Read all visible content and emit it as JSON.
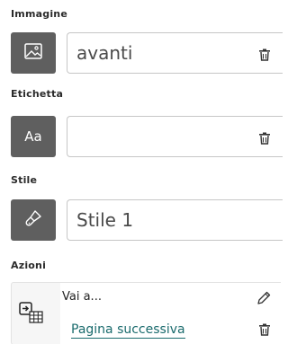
{
  "sections": {
    "image": {
      "label": "Immagine",
      "value": "avanti"
    },
    "label": {
      "label": "Etichetta",
      "value": "",
      "icon_text": "Aa"
    },
    "style": {
      "label": "Stile",
      "value": "Stile 1"
    },
    "actions": {
      "label": "Azioni",
      "items": [
        {
          "title": "Vai a...",
          "target": "Pagina successiva"
        }
      ]
    }
  },
  "icons": {
    "image": "image-icon",
    "label": "text-icon",
    "style": "brush-icon",
    "action": "goto-table-icon",
    "delete": "trash-icon",
    "edit": "pencil-icon"
  },
  "colors": {
    "icon_box": "#5f5f5f",
    "link": "#1a6b6d",
    "border": "#c6c6c6"
  }
}
